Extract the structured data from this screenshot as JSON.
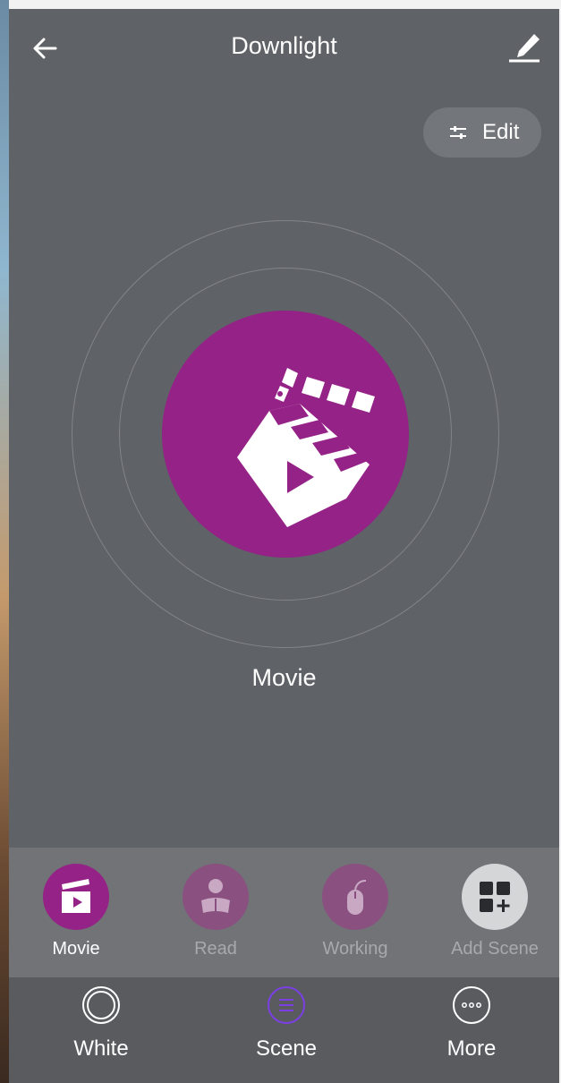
{
  "header": {
    "title": "Downlight"
  },
  "edit_button": {
    "label": "Edit"
  },
  "current_scene": {
    "label": "Movie",
    "color": "#952286"
  },
  "scenes": [
    {
      "label": "Movie",
      "icon": "clapperboard-icon",
      "selected": true
    },
    {
      "label": "Read",
      "icon": "reading-person-icon",
      "selected": false
    },
    {
      "label": "Working",
      "icon": "mouse-icon",
      "selected": false
    },
    {
      "label": "Add Scene",
      "icon": "add-grid-icon",
      "selected": false
    }
  ],
  "nav": [
    {
      "label": "White",
      "icon": "ring-icon",
      "active": false
    },
    {
      "label": "Scene",
      "icon": "menu-circle-icon",
      "active": true,
      "accent": "#7b3fe4"
    },
    {
      "label": "More",
      "icon": "more-dots-icon",
      "active": false
    }
  ]
}
